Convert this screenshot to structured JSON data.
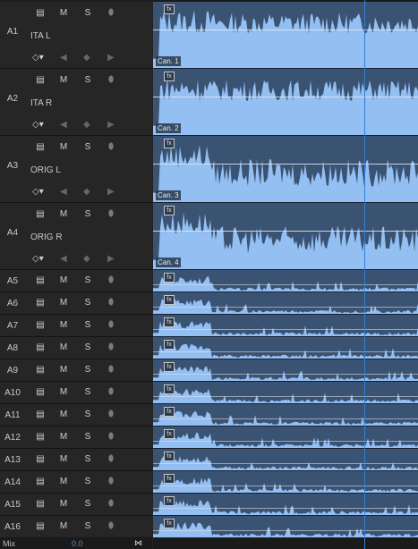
{
  "track_controls": {
    "mute_label": "M",
    "solo_label": "S"
  },
  "tracks": [
    {
      "id": "A1",
      "name": "ITA L",
      "clip_label": "Can. 1",
      "expanded": true
    },
    {
      "id": "A2",
      "name": "ITA R",
      "clip_label": "Can. 2",
      "expanded": true
    },
    {
      "id": "A3",
      "name": "ORIG L",
      "clip_label": "Can. 3",
      "expanded": true
    },
    {
      "id": "A4",
      "name": "ORIG R",
      "clip_label": "Can. 4",
      "expanded": true
    },
    {
      "id": "A5"
    },
    {
      "id": "A6"
    },
    {
      "id": "A7"
    },
    {
      "id": "A8"
    },
    {
      "id": "A9"
    },
    {
      "id": "A10"
    },
    {
      "id": "A11"
    },
    {
      "id": "A12"
    },
    {
      "id": "A13"
    },
    {
      "id": "A14"
    },
    {
      "id": "A15"
    },
    {
      "id": "A16"
    }
  ],
  "fx_badge_label": "fx",
  "footer": {
    "mix_label": "Mix",
    "mix_value": "0.0"
  },
  "icons": {
    "sync": "toggle-sync-icon",
    "voiceover": "microphone-icon",
    "keyframe": "keyframe-diamond-icon",
    "prev_keyframe": "prev-keyframe-icon",
    "next_keyframe": "next-keyframe-icon",
    "clip_menu": "clip-fx-badge-icon",
    "mixer_end": "track-end-icon"
  },
  "colors": {
    "clip": "#3b5373",
    "waveform": "#93bff2",
    "playhead": "#2f7fd8"
  }
}
